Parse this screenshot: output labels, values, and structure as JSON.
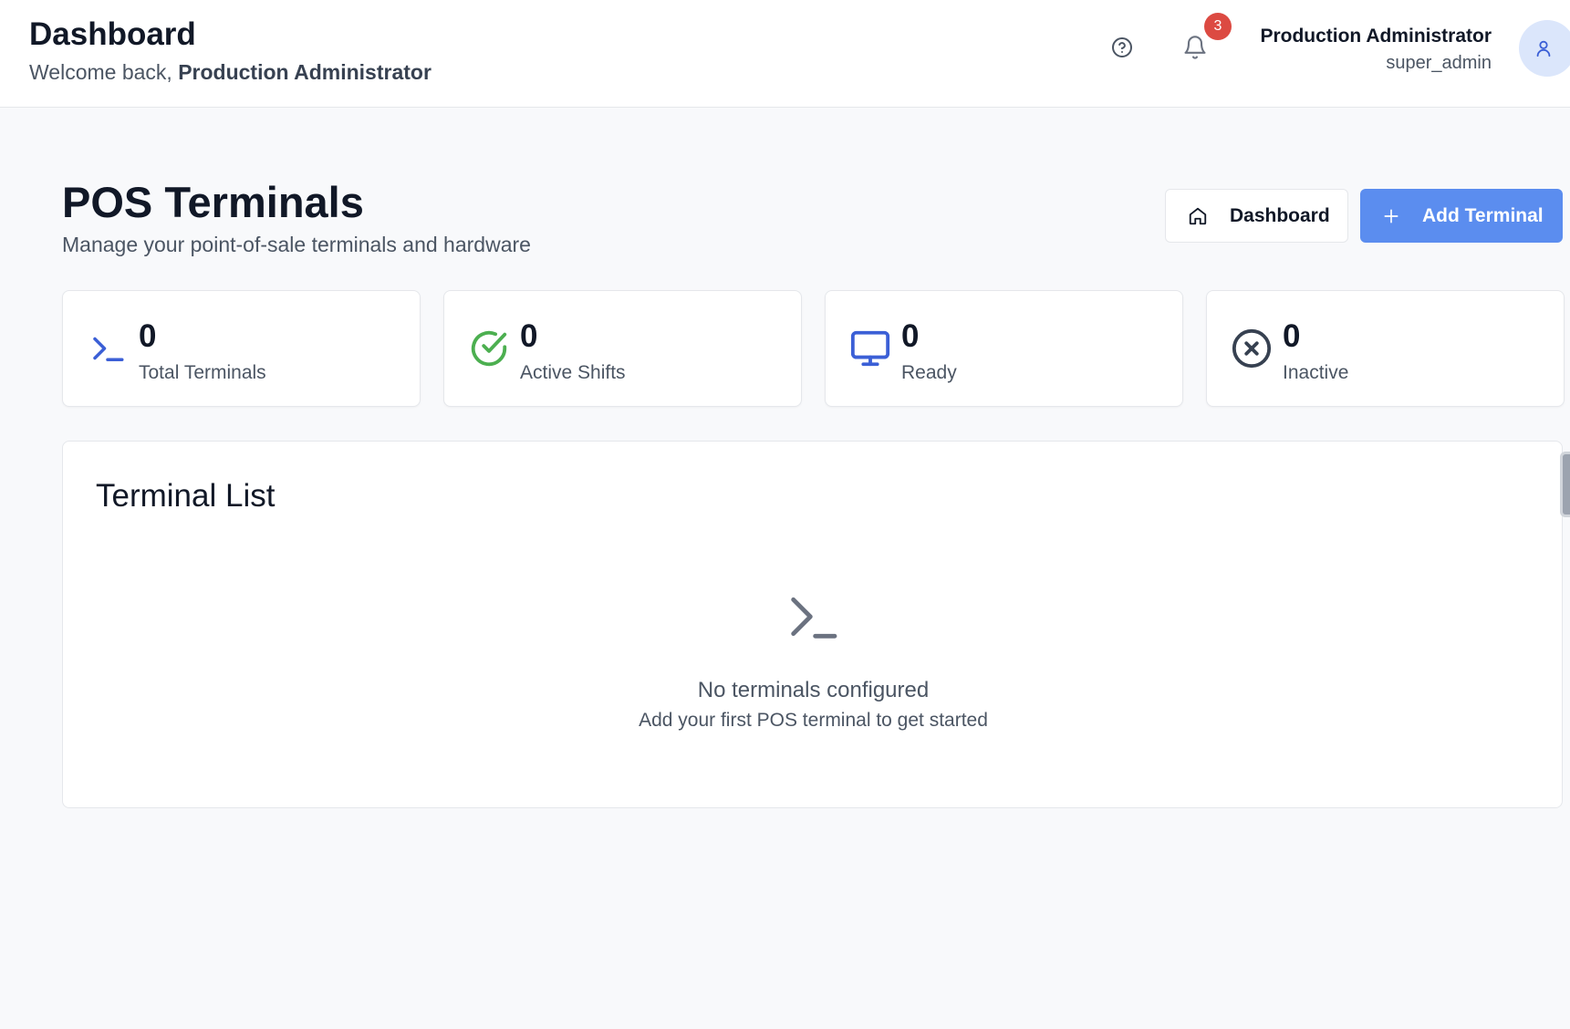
{
  "header": {
    "title": "Dashboard",
    "welcome_prefix": "Welcome back, ",
    "welcome_name": "Production Administrator",
    "notification_count": "3",
    "user_name": "Production Administrator",
    "user_role": "super_admin"
  },
  "page": {
    "title": "POS Terminals",
    "subtitle": "Manage your point-of-sale terminals and hardware",
    "dashboard_button": "Dashboard",
    "add_button": "Add Terminal"
  },
  "stats": [
    {
      "value": "0",
      "label": "Total Terminals",
      "icon": "terminal-icon",
      "color": "#3b5fd6"
    },
    {
      "value": "0",
      "label": "Active Shifts",
      "icon": "check-circle-icon",
      "color": "#4caf50"
    },
    {
      "value": "0",
      "label": "Ready",
      "icon": "monitor-icon",
      "color": "#3b5fd6"
    },
    {
      "value": "0",
      "label": "Inactive",
      "icon": "x-circle-icon",
      "color": "#374151"
    }
  ],
  "terminal_list": {
    "title": "Terminal List",
    "empty_title": "No terminals configured",
    "empty_subtitle": "Add your first POS terminal to get started"
  },
  "colors": {
    "accent": "#5b8def",
    "badge": "#dc4a42",
    "background": "#f8f9fb"
  }
}
